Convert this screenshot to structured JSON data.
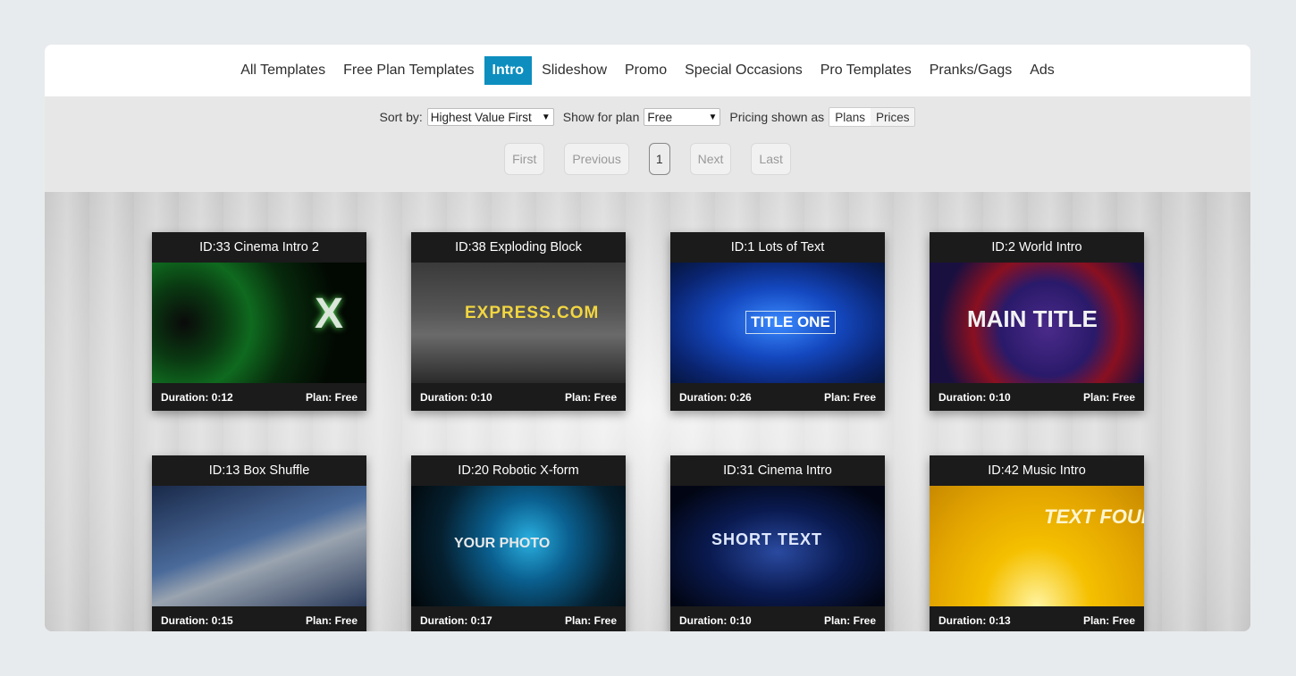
{
  "nav": {
    "tabs": [
      {
        "label": "All Templates"
      },
      {
        "label": "Free Plan Templates"
      },
      {
        "label": "Intro"
      },
      {
        "label": "Slideshow"
      },
      {
        "label": "Promo"
      },
      {
        "label": "Special Occasions"
      },
      {
        "label": "Pro Templates"
      },
      {
        "label": "Pranks/Gags"
      },
      {
        "label": "Ads"
      }
    ],
    "active": "Intro"
  },
  "filters": {
    "sort_label": "Sort by:",
    "sort_value": "Highest Value First",
    "plan_label": "Show for plan",
    "plan_value": "Free",
    "pricing_label": "Pricing shown as",
    "pricing_options": [
      "Plans",
      "Prices"
    ],
    "pricing_selected": "Plans"
  },
  "pager": {
    "first": "First",
    "previous": "Previous",
    "current": "1",
    "next": "Next",
    "last": "Last"
  },
  "cards": [
    {
      "title": "ID:33 Cinema Intro 2",
      "duration": "Duration: 0:12",
      "plan": "Plan: Free",
      "thumb_text": "X"
    },
    {
      "title": "ID:38 Exploding Block",
      "duration": "Duration: 0:10",
      "plan": "Plan: Free",
      "thumb_text": "EXPRESS.COM"
    },
    {
      "title": "ID:1 Lots of Text",
      "duration": "Duration: 0:26",
      "plan": "Plan: Free",
      "thumb_text": "TITLE ONE"
    },
    {
      "title": "ID:2 World Intro",
      "duration": "Duration: 0:10",
      "plan": "Plan: Free",
      "thumb_text": "MAIN TITLE"
    },
    {
      "title": "ID:13 Box Shuffle",
      "duration": "Duration: 0:15",
      "plan": "Plan: Free",
      "thumb_text": ""
    },
    {
      "title": "ID:20 Robotic X-form",
      "duration": "Duration: 0:17",
      "plan": "Plan: Free",
      "thumb_text": "YOUR PHOTO"
    },
    {
      "title": "ID:31 Cinema Intro",
      "duration": "Duration: 0:10",
      "plan": "Plan: Free",
      "thumb_text": "SHORT TEXT"
    },
    {
      "title": "ID:42 Music Intro",
      "duration": "Duration: 0:13",
      "plan": "Plan: Free",
      "thumb_text": "TEXT FOUR"
    }
  ],
  "colors": {
    "accent": "#0d8ebf",
    "card_bg": "#1b1b1b"
  }
}
